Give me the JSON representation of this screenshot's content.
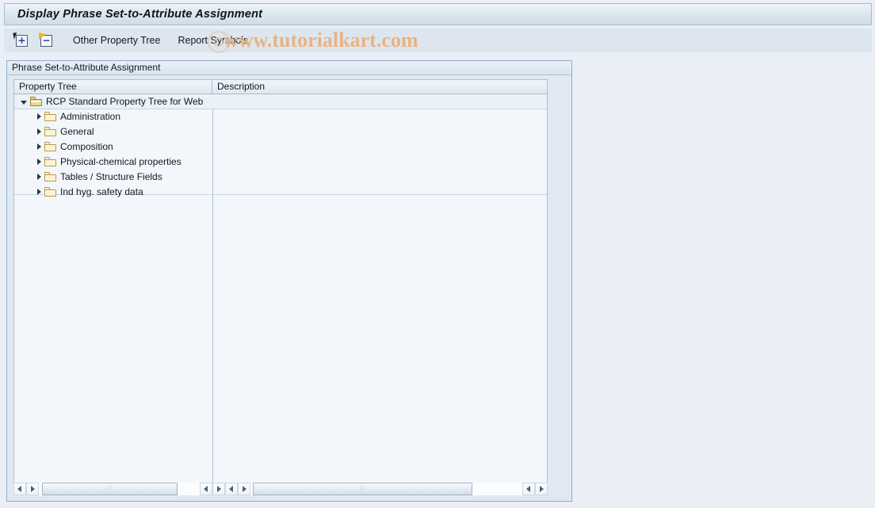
{
  "window": {
    "title": "Display Phrase Set-to-Attribute Assignment"
  },
  "toolbar": {
    "expand_all_icon": "expand-tree-icon",
    "collapse_all_icon": "collapse-tree-icon",
    "expand_sign": "+",
    "collapse_sign": "−",
    "other_property_tree_label": "Other Property Tree",
    "report_symbols_label": "Report Symbols"
  },
  "watermark": {
    "text": "www.tutorialkart.com",
    "color": "#e9b383"
  },
  "panel": {
    "caption": "Phrase Set-to-Attribute Assignment"
  },
  "grid": {
    "columns": [
      {
        "key": "tree",
        "label": "Property Tree"
      },
      {
        "key": "desc",
        "label": "Description"
      }
    ],
    "rows": [
      {
        "label": "RCP Standard Property Tree for Web",
        "level": 0,
        "expanded": true,
        "icon": "open-folder-icon",
        "twisty": "triangle-down-icon",
        "description": ""
      },
      {
        "label": "Administration",
        "level": 1,
        "expanded": false,
        "icon": "closed-folder-icon",
        "twisty": "triangle-right-icon",
        "description": ""
      },
      {
        "label": "General",
        "level": 1,
        "expanded": false,
        "icon": "closed-folder-icon",
        "twisty": "triangle-right-icon",
        "description": ""
      },
      {
        "label": "Composition",
        "level": 1,
        "expanded": false,
        "icon": "closed-folder-icon",
        "twisty": "triangle-right-icon",
        "description": ""
      },
      {
        "label": "Physical-chemical properties",
        "level": 1,
        "expanded": false,
        "icon": "closed-folder-icon",
        "twisty": "triangle-right-icon",
        "description": ""
      },
      {
        "label": "Tables / Structure Fields",
        "level": 1,
        "expanded": false,
        "icon": "closed-folder-icon",
        "twisty": "triangle-right-icon",
        "description": ""
      },
      {
        "label": "Ind hyg. safety data",
        "level": 1,
        "expanded": false,
        "icon": "closed-folder-icon",
        "twisty": "triangle-right-icon",
        "description": ""
      }
    ]
  },
  "scrollbars": {
    "grip": "⁙",
    "left_arrow_icon": "arrow-left-icon",
    "right_arrow_icon": "arrow-right-icon"
  }
}
